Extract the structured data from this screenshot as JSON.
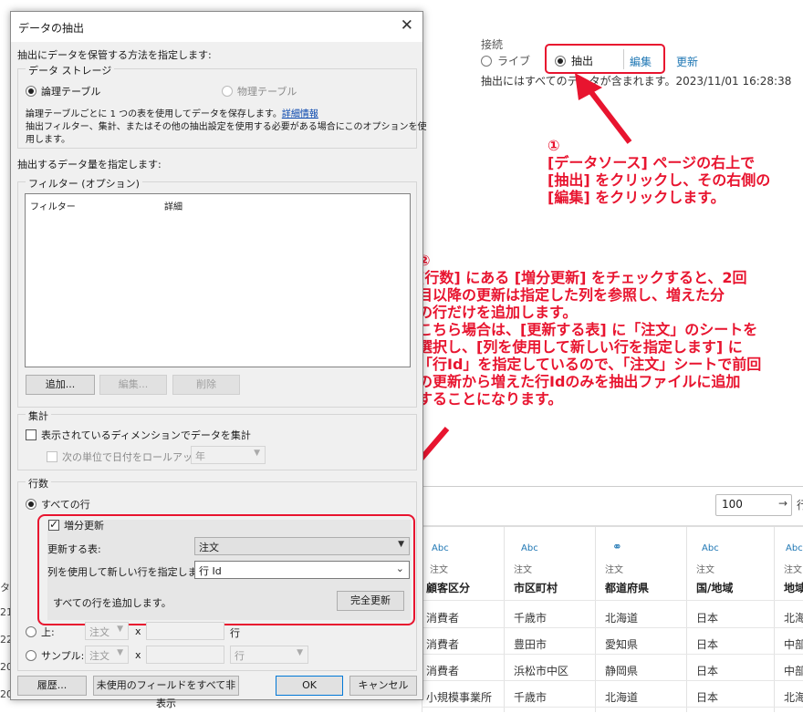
{
  "connection": {
    "title": "接続",
    "live_label": "ライブ",
    "extract_label": "抽出",
    "edit_label": "編集",
    "refresh_label": "更新",
    "extract_note": "抽出にはすべてのデータが含まれます。2023/11/01 16:28:38"
  },
  "annotations": {
    "a1": [
      "①",
      "[データソース] ページの右上で",
      "[抽出] をクリックし、その右側の",
      "[編集] をクリックします。"
    ],
    "a2": [
      "②",
      "[行数] にある [増分更新] をチェックすると、2回",
      "目以降の更新は指定した列を参照し、増えた分",
      "の行だけを追加します。",
      "こちら場合は、[更新する表] に「注文」のシートを",
      "選択し、[列を使用して新しい行を指定します] に",
      "「行Id」を指定しているので、「注文」シートで前回",
      "の更新から増えた行Idのみを抽出ファイルに追加",
      "することになります。"
    ]
  },
  "rows_control": {
    "value": "100",
    "arrow": "→",
    "tail": "行"
  },
  "grid": {
    "columns": [
      {
        "type": "Abc",
        "source": "注文",
        "name": "顧客区分"
      },
      {
        "type": "Abc",
        "source": "注文",
        "name": "市区町村"
      },
      {
        "type": "globe",
        "source": "注文",
        "name": "都道府県"
      },
      {
        "type": "Abc",
        "source": "注文",
        "name": "国/地域"
      },
      {
        "type": "Abc",
        "source": "注文",
        "name": "地域"
      }
    ],
    "rows": [
      [
        "消費者",
        "千歳市",
        "北海道",
        "日本",
        "北海"
      ],
      [
        "消費者",
        "豊田市",
        "愛知県",
        "日本",
        "中部"
      ],
      [
        "消費者",
        "浜松市中区",
        "静岡県",
        "日本",
        "中部"
      ],
      [
        "小規模事業所",
        "千歳市",
        "北海道",
        "日本",
        "北海"
      ]
    ],
    "left_fragments": [
      "タ",
      "21/",
      "22/",
      "20",
      "20"
    ]
  },
  "dialog": {
    "title": "データの抽出",
    "close": "✕",
    "storage_prompt": "抽出にデータを保管する方法を指定します:",
    "storage_group": "データ ストレージ",
    "logical_table": "論理テーブル",
    "physical_table": "物理テーブル",
    "logical_desc_1": "論理テーブルごとに 1 つの表を使用してデータを保存します。",
    "details_link": "詳細情報",
    "logical_desc_2": "抽出フィルター、集計、またはその他の抽出設定を使用する必要がある場合にこのオプションを使",
    "logical_desc_3": "用します。",
    "amount_prompt": "抽出するデータ量を指定します:",
    "filters_group": "フィルター (オプション)",
    "filters_col1": "フィルター",
    "filters_col2": "詳細",
    "add_btn": "追加...",
    "edit_btn": "編集...",
    "delete_btn": "削除",
    "agg_group": "集計",
    "agg_visible_dims": "表示されているディメンションでデータを集計",
    "rollup": "次の単位で日付をロールアップ",
    "rollup_value": "年",
    "rows_group": "行数",
    "all_rows": "すべての行",
    "incremental": "増分更新",
    "table_to_update_label": "更新する表:",
    "table_to_update_value": "注文",
    "new_rows_column_label": "列を使用して新しい行を指定します:",
    "new_rows_column_value": "行 Id",
    "append_all": "すべての行を追加します。",
    "full_refresh": "完全更新",
    "top_label": "上:",
    "top_source": "注文",
    "x_mark": "x",
    "row_unit": "行",
    "sample_label": "サンプル:",
    "sample_source": "注文",
    "sample_unit": "行",
    "history_btn": "履歴...",
    "hide_unused_btn": "未使用のフィールドをすべて非表示",
    "ok_btn": "OK",
    "cancel_btn": "キャンセル"
  }
}
